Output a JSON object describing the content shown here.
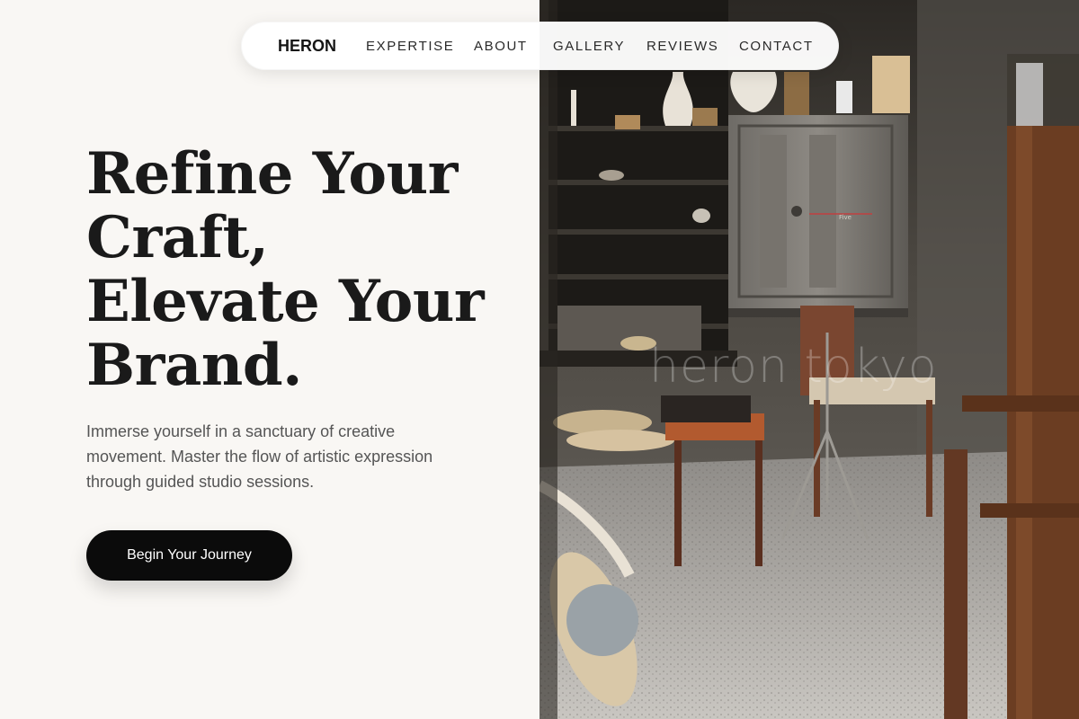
{
  "nav": {
    "brand": "HERON",
    "links": [
      "EXPERTISE",
      "ABOUT",
      "GALLERY",
      "REVIEWS",
      "CONTACT"
    ]
  },
  "hero": {
    "title_lines": [
      "Refine Your",
      "Craft,",
      "Elevate Your",
      "Brand."
    ],
    "subtitle": "Immerse yourself in a sanctuary of creative movement. Master the flow of artistic expression through guided studio sessions.",
    "cta_label": "Begin Your Journey"
  },
  "image": {
    "description_icon": "studio-photo",
    "watermark": "heron tokyo",
    "kiln_label": "Five"
  },
  "colors": {
    "background": "#f9f7f4",
    "text": "#1a1a1a",
    "cta": "#0b0b0b"
  }
}
